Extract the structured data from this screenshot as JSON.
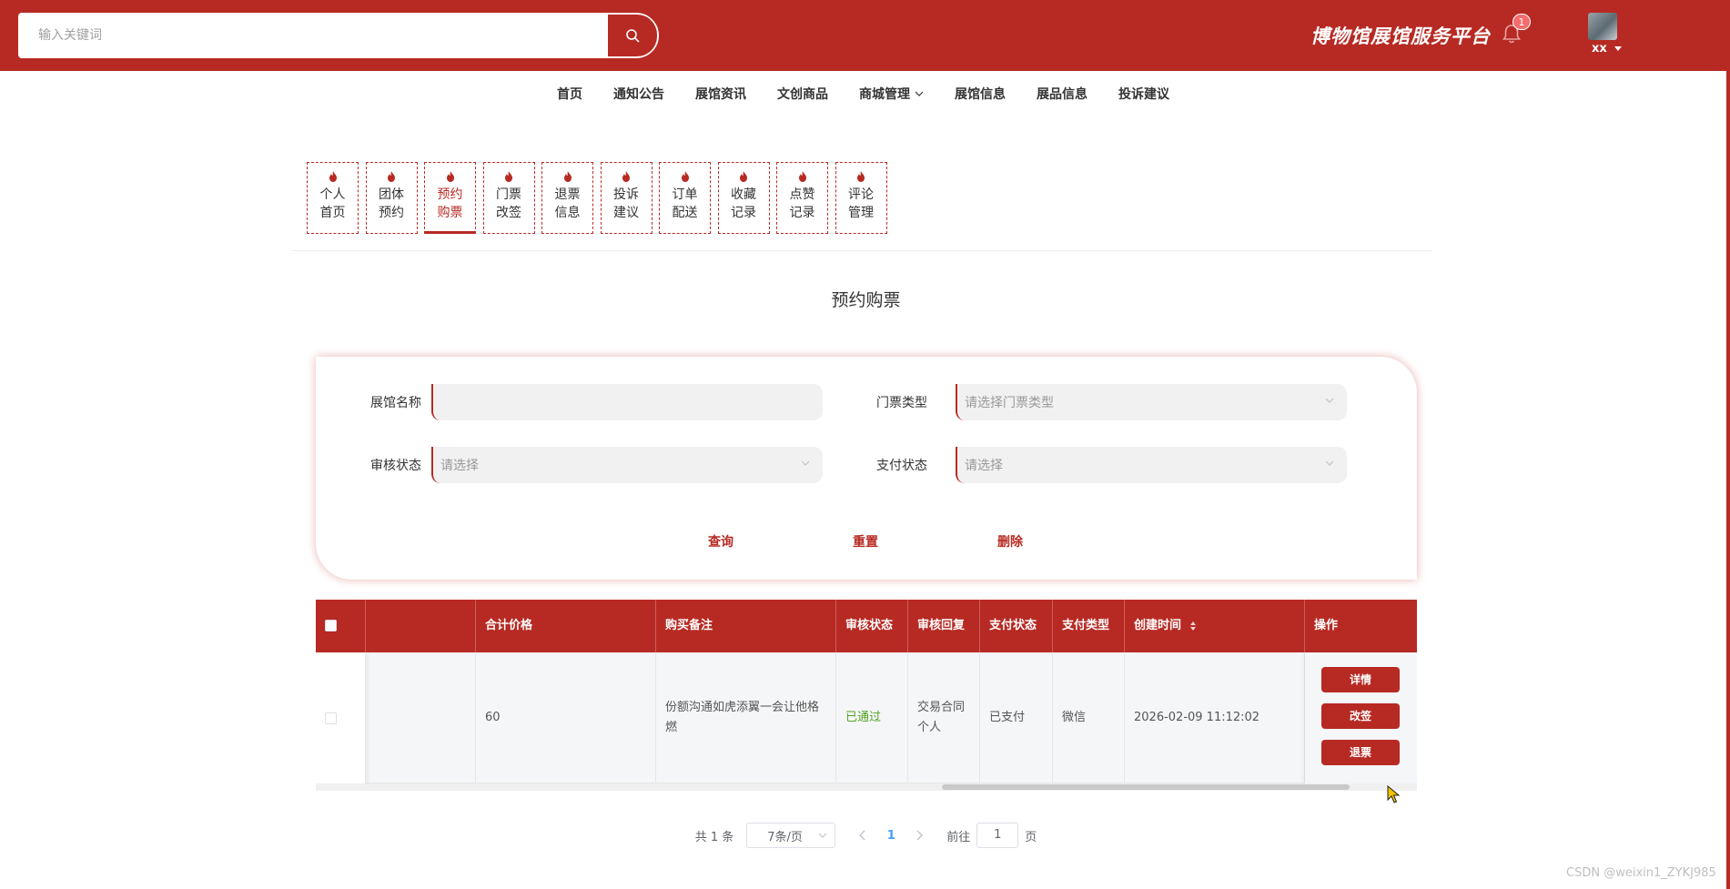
{
  "header": {
    "search_placeholder": "输入关键词",
    "platform_title": "博物馆展馆服务平台",
    "notification_count": "1",
    "user_name": "xx"
  },
  "nav": {
    "items": [
      "首页",
      "通知公告",
      "展馆资讯",
      "文创商品",
      "商城管理",
      "展馆信息",
      "展品信息",
      "投诉建议"
    ]
  },
  "tabs": [
    {
      "label": "个人首页"
    },
    {
      "label": "团体预约"
    },
    {
      "label": "预约购票"
    },
    {
      "label": "门票改签"
    },
    {
      "label": "退票信息"
    },
    {
      "label": "投诉建议"
    },
    {
      "label": "订单配送"
    },
    {
      "label": "收藏记录"
    },
    {
      "label": "点赞记录"
    },
    {
      "label": "评论管理"
    }
  ],
  "active_tab": "预约购票",
  "page_title": "预约购票",
  "filter": {
    "hall_name_label": "展馆名称",
    "hall_name_value": "",
    "ticket_type_label": "门票类型",
    "ticket_type_placeholder": "请选择门票类型",
    "review_status_label": "审核状态",
    "review_status_placeholder": "请选择",
    "pay_status_label": "支付状态",
    "pay_status_placeholder": "请选择",
    "query_label": "查询",
    "reset_label": "重置",
    "delete_label": "删除"
  },
  "table": {
    "columns": [
      "合计价格",
      "购买备注",
      "审核状态",
      "审核回复",
      "支付状态",
      "支付类型",
      "创建时间",
      "操作"
    ],
    "rows": [
      {
        "total_price": "60",
        "remark": "份额沟通如虎添翼一会让他格燃",
        "review_status": "已通过",
        "review_reply": "交易合同个人",
        "pay_status": "已支付",
        "pay_type": "微信",
        "created_at": "2026-02-09 11:12:02"
      }
    ],
    "actions": [
      "详情",
      "改签",
      "退票"
    ],
    "status_color": "#52a322"
  },
  "pagination": {
    "total": "共 1 条",
    "page_size": "7条/页",
    "current_page": "1",
    "goto_label": "前往",
    "goto_value": "1",
    "page_unit": "页"
  },
  "watermark": "CSDN @weixin1_ZYKJ985",
  "theme": {
    "primary": "#b72a23",
    "link": "#409eff"
  }
}
